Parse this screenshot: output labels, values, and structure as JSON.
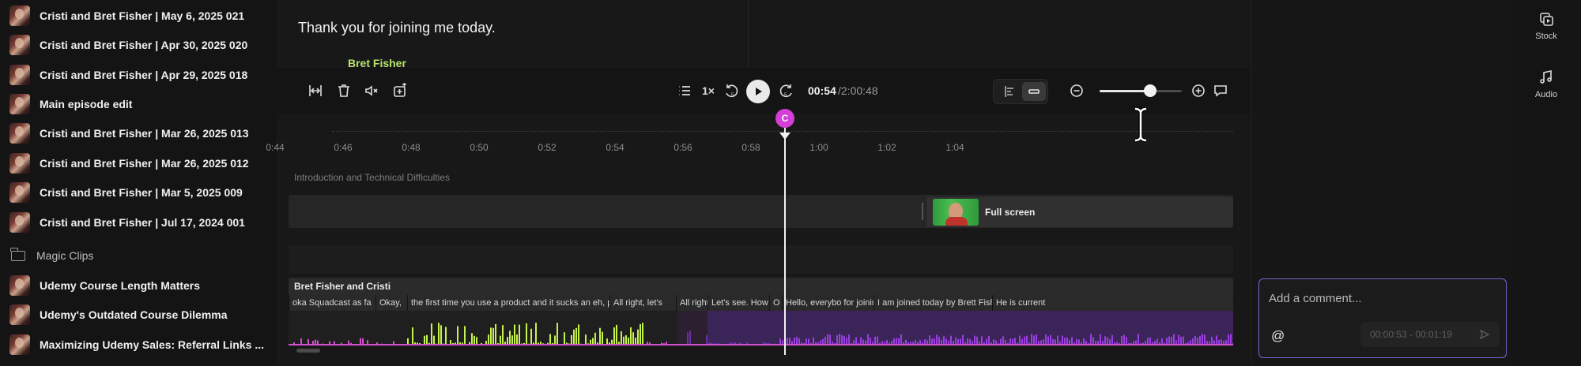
{
  "sidebar": {
    "projects": [
      {
        "label": "Cristi and Bret Fisher | May 6, 2025 021"
      },
      {
        "label": "Cristi and Bret Fisher | Apr 30, 2025 020"
      },
      {
        "label": "Cristi and Bret Fisher | Apr 29, 2025 018"
      },
      {
        "label": "Main episode edit"
      },
      {
        "label": "Cristi and Bret Fisher | Mar 26, 2025 013"
      },
      {
        "label": "Cristi and Bret Fisher | Mar 26, 2025 012"
      },
      {
        "label": "Cristi and Bret Fisher | Mar 5, 2025 009"
      },
      {
        "label": "Cristi and Bret Fisher | Jul 17, 2024 001"
      }
    ],
    "folder": {
      "label": "Magic Clips",
      "icon": "folder-icon"
    },
    "clips": [
      {
        "label": "Udemy Course Length Matters"
      },
      {
        "label": "Udemy's Outdated Course Dilemma"
      },
      {
        "label": "Maximizing Udemy Sales: Referral Links ..."
      }
    ]
  },
  "transcript": {
    "line": "Thank  you for joining me today.",
    "next_speaker": "Bret Fisher"
  },
  "toolbar": {
    "speed": "1×",
    "skip_back_seconds": "5",
    "skip_forward_seconds": "5",
    "time_current": "00:54",
    "time_total": "/2:00:48",
    "zoom_level": 0.62
  },
  "ruler": {
    "ticks": [
      "0:44",
      "0:46",
      "0:48",
      "0:50",
      "0:52",
      "0:54",
      "0:56",
      "0:58",
      "1:00",
      "1:02",
      "1:04"
    ]
  },
  "timeline": {
    "section_title": "Introduction and Technical Difficulties",
    "scene_clip_label": "Full screen",
    "audio_track_name": "Bret Fisher and Cristi",
    "playhead_marker": "C",
    "words": [
      "oka Squadcast as fa",
      "Okay,",
      "the first time you use a product and it sucks an eh, probably not",
      "All right, let's",
      "All right.",
      "Let's see. How do",
      "O",
      "Hello, everybo for joining",
      "I am joined today by Brett Fisher, my",
      "He is current"
    ]
  },
  "comments": {
    "placeholder": "Add a comment...",
    "mention_symbol": "@",
    "range": "00:00:53 - 00:01:19"
  },
  "rail": {
    "items": [
      {
        "label": "Stock",
        "icon": "stock-icon"
      },
      {
        "label": "Audio",
        "icon": "audio-note-icon"
      }
    ]
  },
  "colors": {
    "accent_purple": "#9b3fe0",
    "wave_green": "#c6f24e",
    "wave_pink": "#d24fd0",
    "speaker_green": "#b7e36b",
    "playhead_marker": "#d43fd8",
    "comment_border": "#7b61d1"
  }
}
